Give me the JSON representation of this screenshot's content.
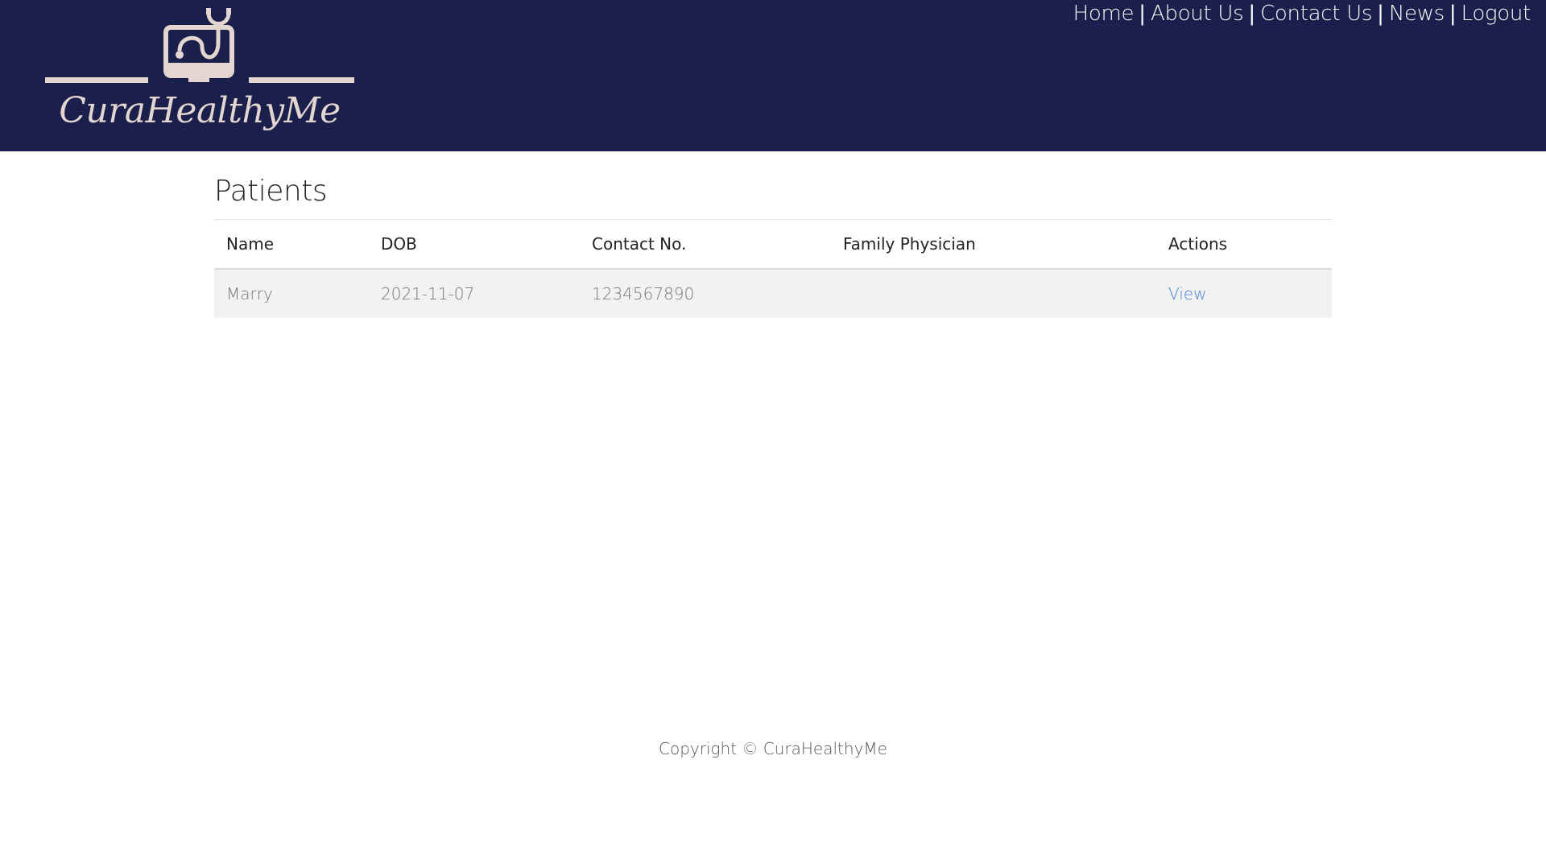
{
  "brand": {
    "name": "CuraHealthyMe",
    "logo_icon": "monitor-stethoscope-icon",
    "logo_color": "#e3d5d0",
    "header_bg": "#1a1f4b"
  },
  "nav": {
    "items": [
      {
        "label": "Home"
      },
      {
        "label": "About Us"
      },
      {
        "label": "Contact Us"
      },
      {
        "label": "News"
      },
      {
        "label": "Logout"
      }
    ],
    "separator": "|"
  },
  "main": {
    "title": "Patients",
    "table": {
      "columns": [
        "Name",
        "DOB",
        "Contact No.",
        "Family Physician",
        "Actions"
      ],
      "rows": [
        {
          "name": "Marry",
          "dob": "2021-11-07",
          "contact": "1234567890",
          "physician": "",
          "action": "View"
        }
      ]
    }
  },
  "footer": {
    "text": "Copyright © CuraHealthyMe"
  },
  "colors": {
    "link": "#4a7fd4",
    "row_bg": "#f2f2f2"
  }
}
